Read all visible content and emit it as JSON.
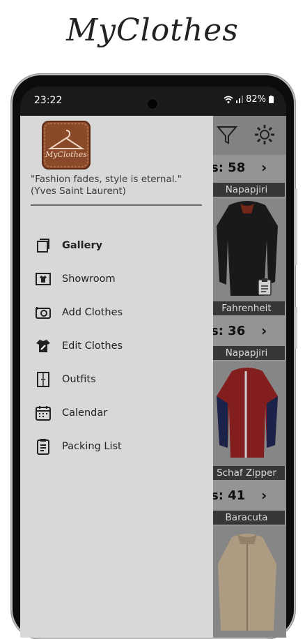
{
  "brand": "MyClothes",
  "status": {
    "time": "23:22",
    "battery": "82%"
  },
  "drawer": {
    "logo_text": "MyClothes",
    "quote": "\"Fashion fades, style is eternal.\" (Yves Saint Laurent)",
    "items": [
      {
        "label": "Gallery",
        "icon": "gallery-icon",
        "selected": true
      },
      {
        "label": "Showroom",
        "icon": "showroom-icon",
        "selected": false
      },
      {
        "label": "Add Clothes",
        "icon": "add-clothes-icon",
        "selected": false
      },
      {
        "label": "Edit Clothes",
        "icon": "edit-clothes-icon",
        "selected": false
      },
      {
        "label": "Outfits",
        "icon": "outfits-icon",
        "selected": false
      },
      {
        "label": "Calendar",
        "icon": "calendar-icon",
        "selected": false
      },
      {
        "label": "Packing List",
        "icon": "packing-list-icon",
        "selected": false
      }
    ]
  },
  "background": {
    "cards": [
      {
        "count": "s: 58",
        "brand": "Napapjiri",
        "name": "Fahrenheit"
      },
      {
        "count": "s: 36",
        "brand": "Napapjiri",
        "name": "Schaf Zipper"
      },
      {
        "count": "s: 41",
        "brand": "Baracuta",
        "name": ""
      }
    ]
  }
}
